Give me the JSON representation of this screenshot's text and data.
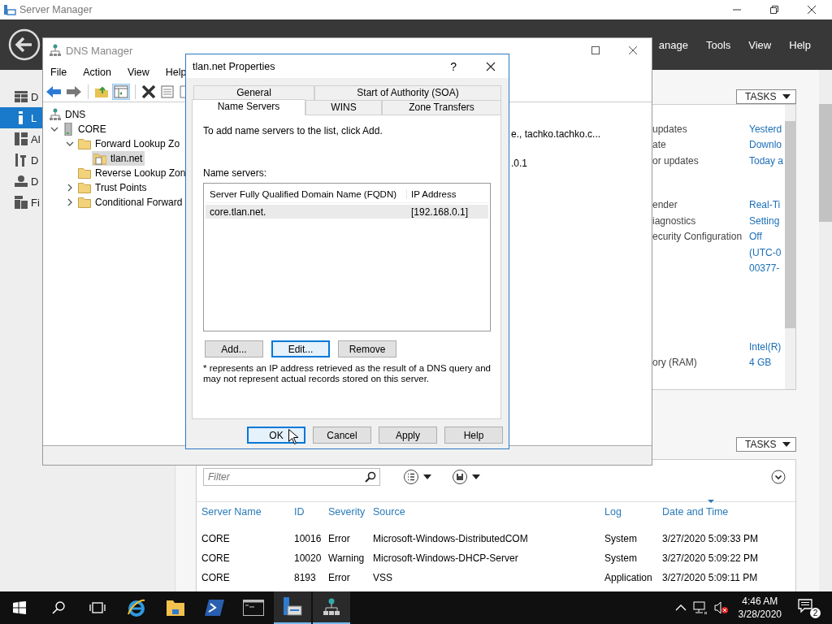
{
  "server_manager": {
    "title": "Server Manager",
    "menu": [
      "anage",
      "Tools",
      "View",
      "Help"
    ],
    "sidebar": [
      {
        "label": "D",
        "selected": false
      },
      {
        "label": "L",
        "selected": true
      },
      {
        "label": "Al",
        "selected": false
      },
      {
        "label": "D",
        "selected": false
      },
      {
        "label": "D",
        "selected": false
      },
      {
        "label": "Fi",
        "selected": false
      }
    ],
    "properties": {
      "tasks": "TASKS",
      "groups": [
        [
          {
            "label": "updates",
            "value": "Yesterd"
          },
          {
            "label": "ate",
            "value": "Downlo"
          },
          {
            "label": "or updates",
            "value": "Today a"
          }
        ],
        [
          {
            "label": "ender",
            "value": "Real-Ti"
          },
          {
            "label": "iagnostics",
            "value": "Setting"
          },
          {
            "label": "ecurity Configuration",
            "value": "Off"
          },
          {
            "value": "(UTC-0"
          },
          {
            "value": "00377-"
          }
        ],
        [
          {
            "value": "Intel(R)"
          },
          {
            "label": "ory (RAM)",
            "value": "4 GB"
          }
        ]
      ]
    },
    "events": {
      "tasks": "TASKS",
      "filter_placeholder": "Filter",
      "columns": [
        "Server Name",
        "ID",
        "Severity",
        "Source",
        "Log",
        "Date and Time"
      ],
      "rows": [
        [
          "CORE",
          "10016",
          "Error",
          "Microsoft-Windows-DistributedCOM",
          "System",
          "3/27/2020 5:09:33 PM"
        ],
        [
          "CORE",
          "10020",
          "Warning",
          "Microsoft-Windows-DHCP-Server",
          "System",
          "3/27/2020 5:09:22 PM"
        ],
        [
          "CORE",
          "8193",
          "Error",
          "VSS",
          "Application",
          "3/27/2020 5:09:11 PM"
        ]
      ]
    }
  },
  "dns_manager": {
    "title": "DNS Manager",
    "menu": [
      "File",
      "Action",
      "View",
      "Help"
    ],
    "tree": [
      {
        "label": "DNS",
        "selected": false,
        "children": [
          {
            "label": "CORE",
            "selected": false,
            "expanded": true,
            "children": [
              {
                "label": "Forward Lookup Zo",
                "selected": false,
                "expanded": true,
                "children": [
                  {
                    "label": "tlan.net",
                    "selected": true
                  }
                ]
              },
              {
                "label": "Reverse Lookup Zon",
                "selected": false
              },
              {
                "label": "Trust Points",
                "selected": false,
                "expanded": false
              },
              {
                "label": "Conditional Forward",
                "selected": false,
                "expanded": false
              }
            ]
          }
        ]
      }
    ],
    "details": [
      "e., tachko.tachko.c...",
      ".0.1"
    ]
  },
  "dialog": {
    "title": "tlan.net Properties",
    "help": "?",
    "tab_rows": [
      [
        {
          "label": "General",
          "selected": false
        },
        {
          "label": "Start of Authority (SOA)",
          "selected": false
        }
      ],
      [
        {
          "label": "Name Servers",
          "selected": true
        },
        {
          "label": "WINS",
          "selected": false
        },
        {
          "label": "Zone Transfers",
          "selected": false
        }
      ]
    ],
    "intro": "To add name servers to the list, click Add.",
    "list_label": "Name servers:",
    "columns": [
      "Server Fully Qualified Domain Name (FQDN)",
      "IP Address"
    ],
    "rows": [
      {
        "fqdn": "core.tlan.net.",
        "ip": "[192.168.0.1]",
        "selected": true
      }
    ],
    "list_buttons": [
      {
        "label": "Add...",
        "focused": false
      },
      {
        "label": "Edit...",
        "focused": true
      },
      {
        "label": "Remove",
        "focused": false
      }
    ],
    "note": "* represents an IP address retrieved as the result of a DNS query and may not represent actual records stored on this server.",
    "buttons": [
      {
        "label": "OK",
        "focused": true
      },
      {
        "label": "Cancel",
        "focused": false
      },
      {
        "label": "Apply",
        "focused": false
      },
      {
        "label": "Help",
        "focused": false
      }
    ]
  },
  "taskbar": {
    "apps": [
      {
        "active": false
      },
      {
        "active": false
      },
      {
        "active": false
      },
      {
        "active": false
      },
      {
        "active": true
      },
      {
        "active": true
      }
    ],
    "time": "4:46 AM",
    "date": "3/28/2020",
    "notifications": "2"
  }
}
